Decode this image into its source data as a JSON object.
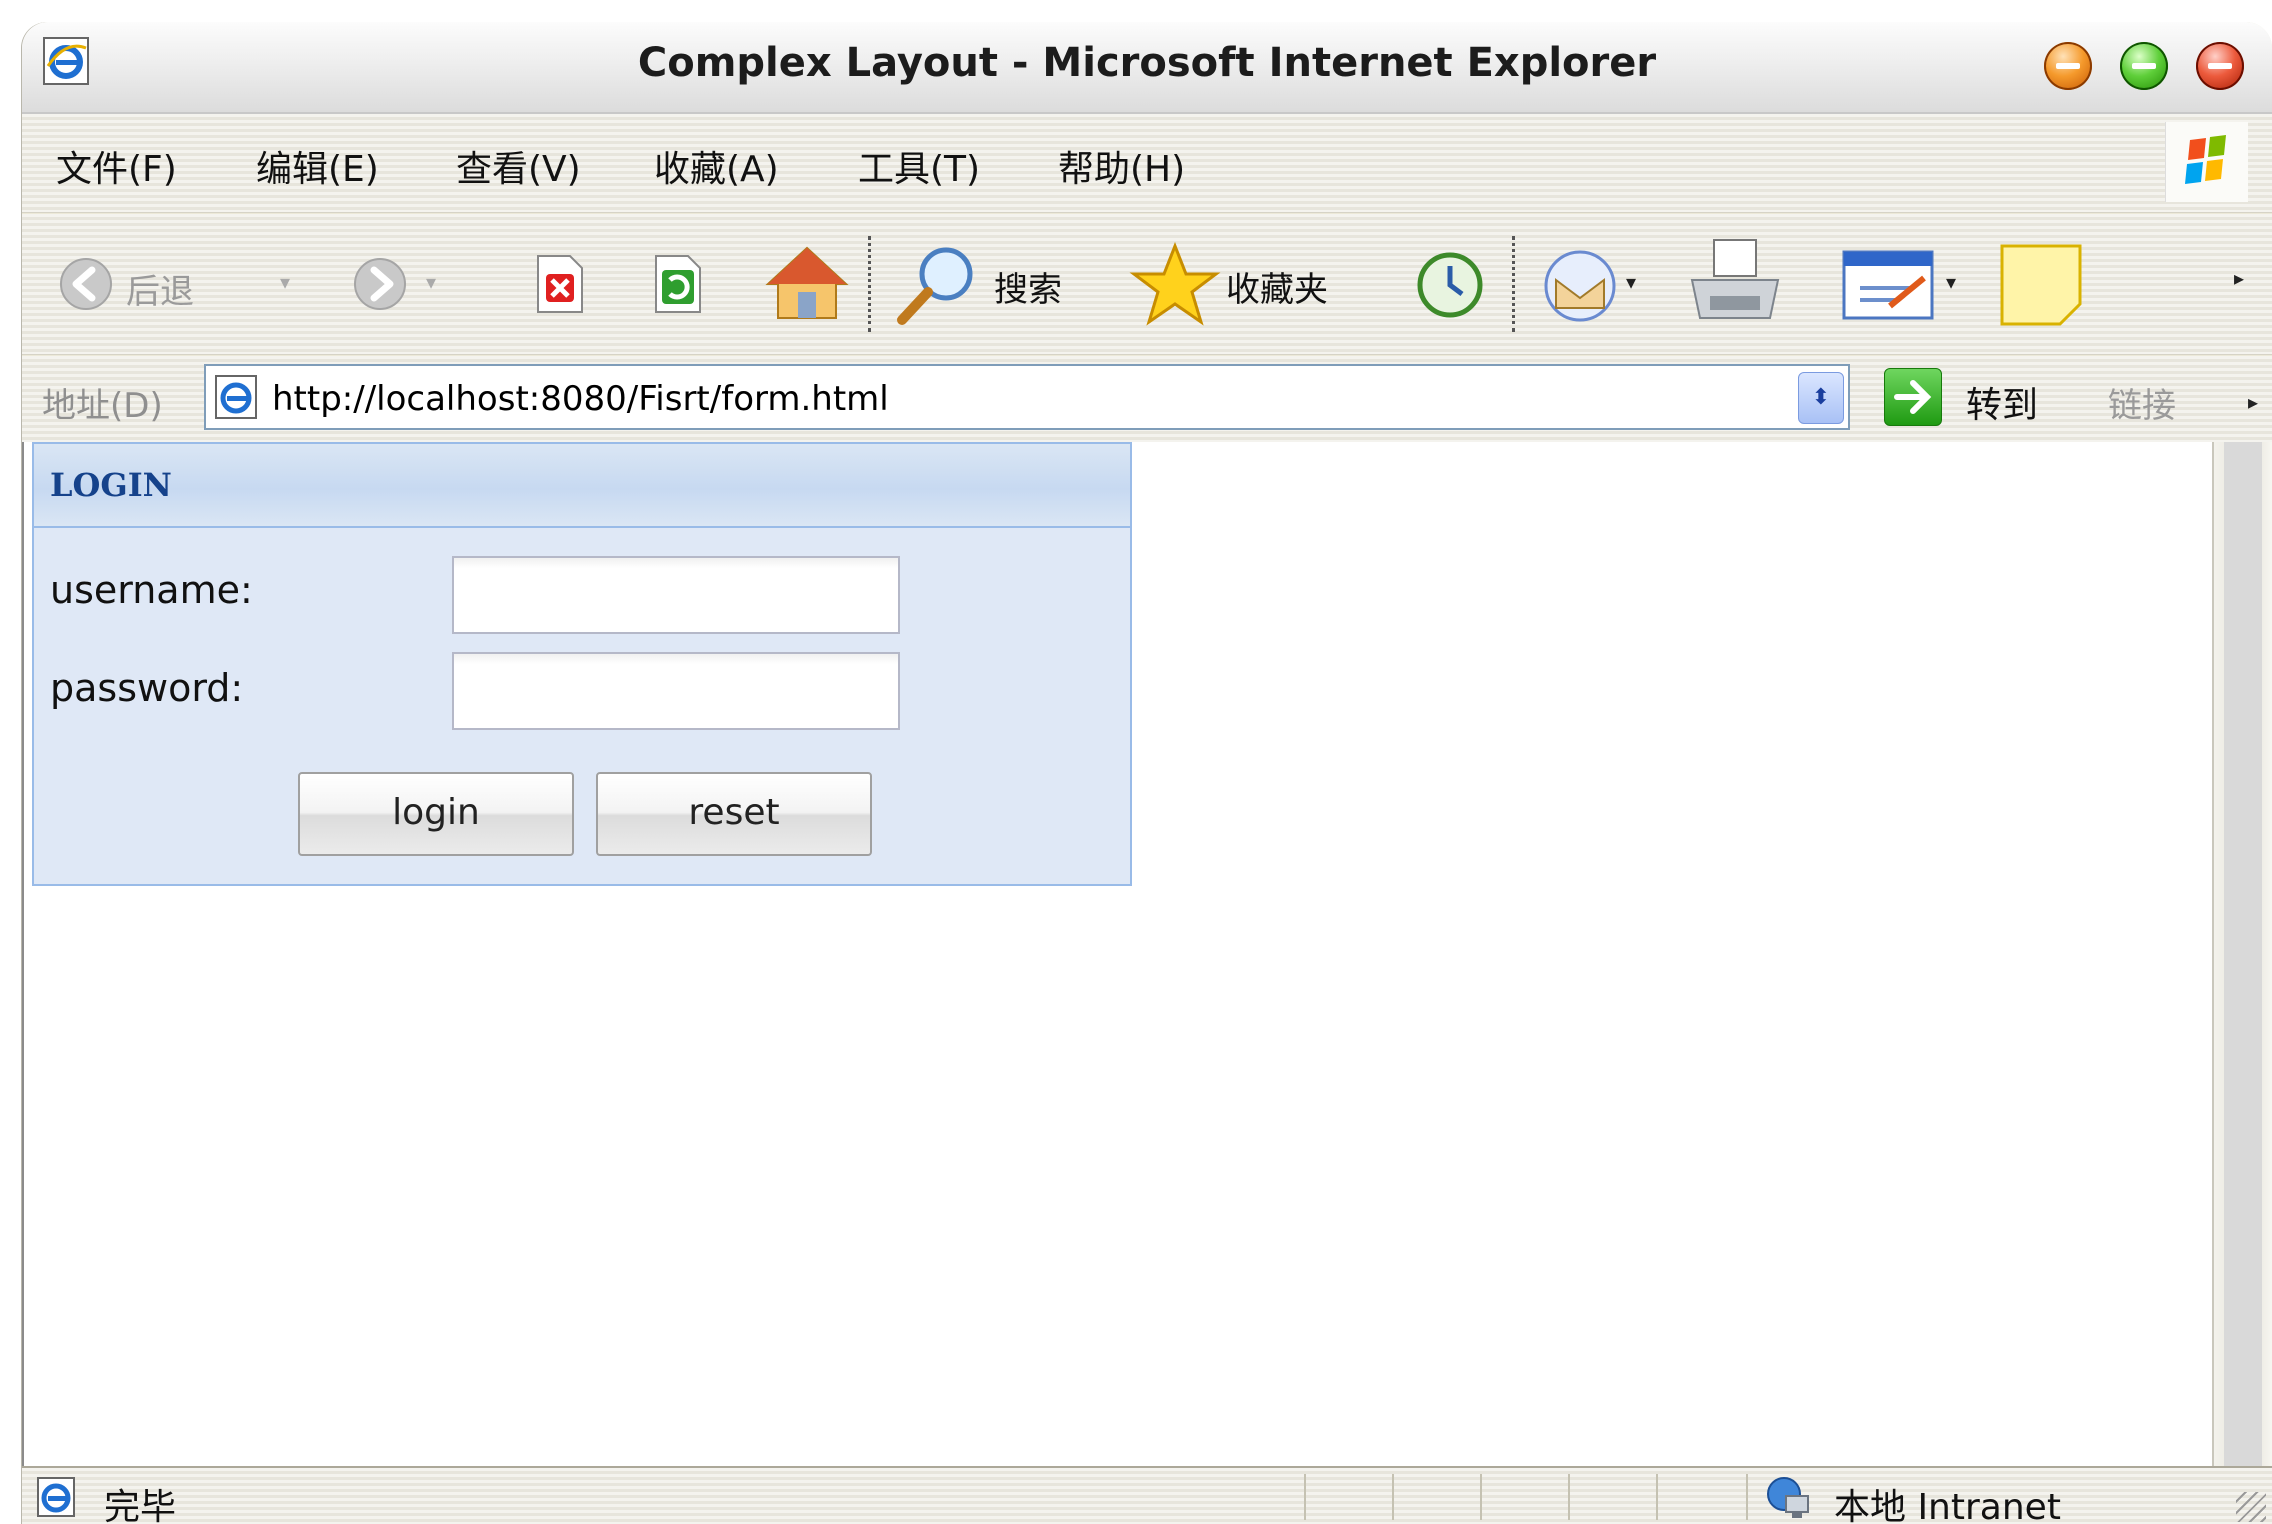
{
  "window": {
    "title": "Complex Layout - Microsoft Internet Explorer"
  },
  "menubar": {
    "items": [
      "文件(F)",
      "编辑(E)",
      "查看(V)",
      "收藏(A)",
      "工具(T)",
      "帮助(H)"
    ]
  },
  "toolbar": {
    "back_label": "后退",
    "search_label": "搜索",
    "favorites_label": "收藏夹"
  },
  "addressbar": {
    "label": "地址(D)",
    "url": "http://localhost:8080/Fisrt/form.html",
    "go_label": "转到",
    "links_label": "链接"
  },
  "login_panel": {
    "title": "LOGIN",
    "username_label": "username:",
    "username_value": "",
    "password_label": "password:",
    "password_value": "",
    "login_button": "login",
    "reset_button": "reset"
  },
  "statusbar": {
    "status_text": "完毕",
    "zone_text": "本地 Intranet"
  }
}
